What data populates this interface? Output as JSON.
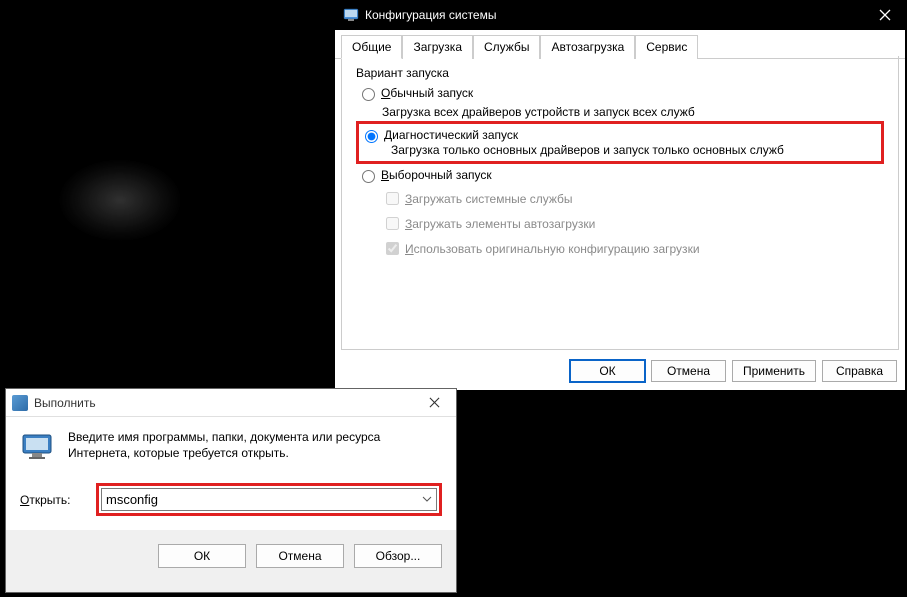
{
  "msconfig": {
    "title": "Конфигурация системы",
    "tabs": [
      "Общие",
      "Загрузка",
      "Службы",
      "Автозагрузка",
      "Сервис"
    ],
    "group_label": "Вариант запуска",
    "normal": {
      "u": "О",
      "label_rest": "бычный запуск",
      "desc": "Загрузка всех драйверов устройств и запуск всех служб"
    },
    "diag": {
      "u": "Д",
      "label_rest": "иагностический запуск",
      "desc": "Загрузка только основных драйверов и запуск только основных служб"
    },
    "selective": {
      "u": "В",
      "label_rest": "ыборочный запуск",
      "chk1_u": "З",
      "chk1_rest": "агружать системные службы",
      "chk2_u": "З",
      "chk2_rest": "агружать элементы автозагрузки",
      "chk3_u": "И",
      "chk3_rest": "спользовать оригинальную конфигурацию загрузки"
    },
    "buttons": {
      "ok": "ОК",
      "cancel": "Отмена",
      "apply": "Применить",
      "help": "Справка"
    }
  },
  "run": {
    "title": "Выполнить",
    "desc": "Введите имя программы, папки, документа или ресурса Интернета, которые требуется открыть.",
    "open_u": "О",
    "open_rest": "ткрыть:",
    "value": "msconfig",
    "buttons": {
      "ok": "ОК",
      "cancel": "Отмена",
      "browse": "Обзор..."
    }
  }
}
